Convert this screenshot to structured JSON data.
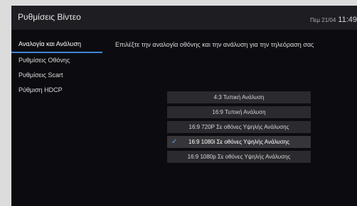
{
  "header": {
    "title": "Ρυθμίσεις Βίντεο",
    "date": "Πεμ 21/04",
    "time": "11:49"
  },
  "sidebar": {
    "items": [
      {
        "label": "Αναλογία και Ανάλυση",
        "active": true
      },
      {
        "label": "Ρυθμίσεις Οθόνης"
      },
      {
        "label": "Ρυθμίσεις Scart"
      },
      {
        "label": "Ρύθμιση HDCP"
      }
    ]
  },
  "main": {
    "description": "Επιλέξτε την αναλογία οθόνης και την ανάλυση για την τηλεόραση σας",
    "options": [
      {
        "label": "4:3 Τυπική Ανάλυση"
      },
      {
        "label": "16:9 Τυπική Ανάλυση"
      },
      {
        "label": "16:9 720P Σε οθόνες Υψηλής Ανάλυσης"
      },
      {
        "label": "16:9 1080i Σε οθόνες Υψηλής Ανάλυσης",
        "selected": true
      },
      {
        "label": "16:9 1080p Σε οθόνες Υψηλής Ανάλυσης"
      }
    ]
  },
  "colors": {
    "accent": "#3f86d6",
    "check": "#5aa0ea",
    "background": "#0c0c10",
    "header": "#1e1e22",
    "option": "#2b2b2f"
  },
  "icons": {
    "selected_option": "checkmark-icon"
  }
}
